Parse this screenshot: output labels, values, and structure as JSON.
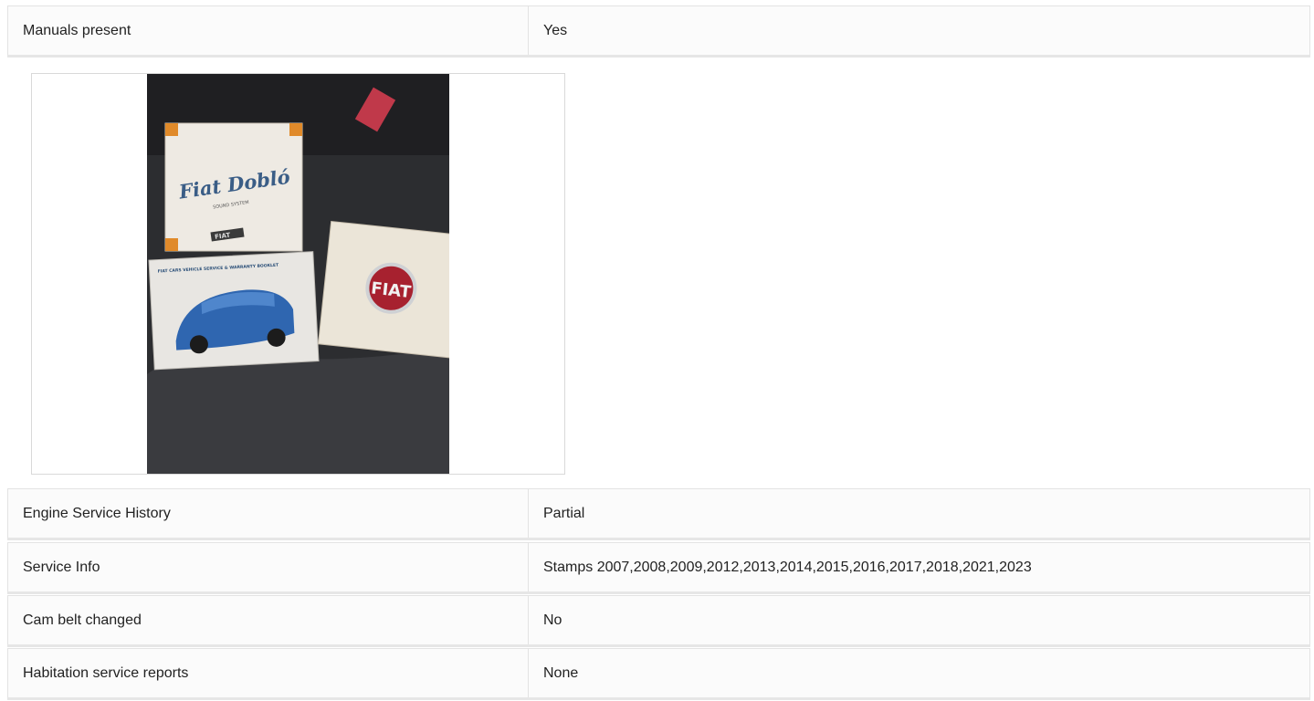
{
  "rows_top": [
    {
      "label": "Manuals present",
      "value": "Yes"
    }
  ],
  "photo": {
    "booklet_left_title": "Fiat Dobló",
    "booklet_left_sub": "SOUND SYSTEM",
    "booklet_left_brand": "FIAT",
    "booklet_center_title": "FIAT CARS VEHICLE SERVICE & WARRANTY BOOKLET",
    "booklet_right_logo": "FIAT"
  },
  "rows_bottom": [
    {
      "label": "Engine Service History",
      "value": "Partial"
    },
    {
      "label": "Service Info",
      "value": "Stamps 2007,2008,2009,2012,2013,2014,2015,2016,2017,2018,2021,2023"
    },
    {
      "label": "Cam belt changed",
      "value": "No"
    },
    {
      "label": "Habitation service reports",
      "value": "None"
    }
  ]
}
